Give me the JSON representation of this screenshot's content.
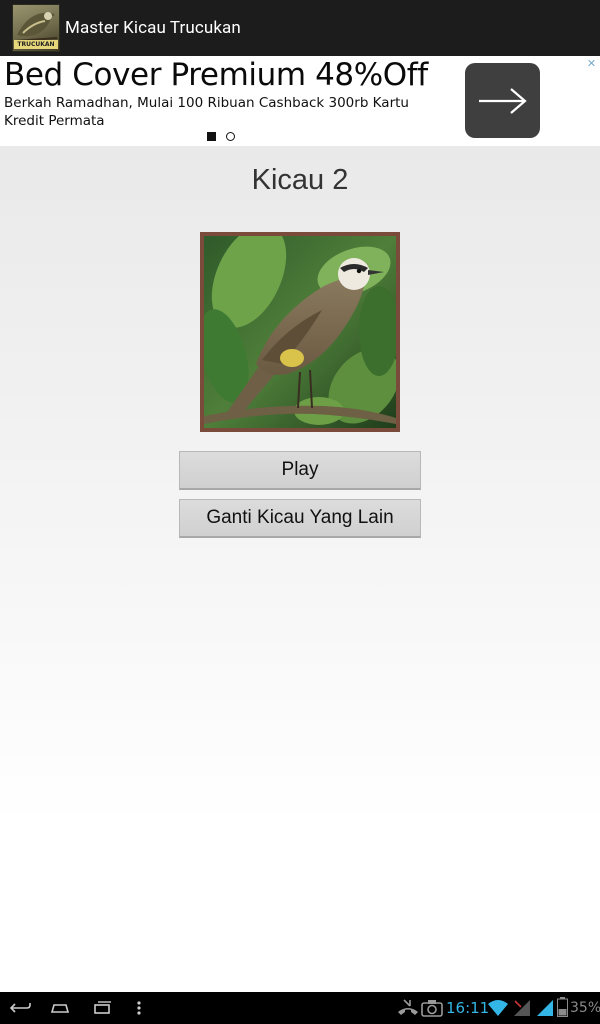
{
  "action_bar": {
    "title": "Master Kicau Trucukan",
    "app_icon_label": "TRUCUKAN",
    "app_icon": "trucukan-bird-icon"
  },
  "ad": {
    "headline": "Bed Cover Premium 48%Off",
    "body": "Berkah Ramadhan, Mulai 100 Ribuan Cashback 300rb Kartu Kredit Permata",
    "cta_icon": "arrow-right-icon",
    "choices_icon": "ad-choices-icon",
    "pager": {
      "active_index": 0,
      "count": 2
    }
  },
  "main": {
    "title": "Kicau 2",
    "image": "yellow-vented-bulbul-photo",
    "buttons": {
      "play": "Play",
      "change": "Ganti Kicau Yang Lain"
    }
  },
  "system_bar": {
    "nav": [
      "back-icon",
      "home-icon",
      "recent-apps-icon",
      "menu-icon"
    ],
    "status_icons": [
      "missed-call-icon",
      "camera-icon",
      "wifi-icon",
      "signal-icon",
      "battery-icon"
    ],
    "time": "16:11",
    "battery": "35%"
  },
  "colors": {
    "action_bar_bg": "#1c1c1c",
    "status_accent": "#33b5e5",
    "frame_border": "#7a4a3a",
    "cta_bg": "#3f3f3f"
  }
}
